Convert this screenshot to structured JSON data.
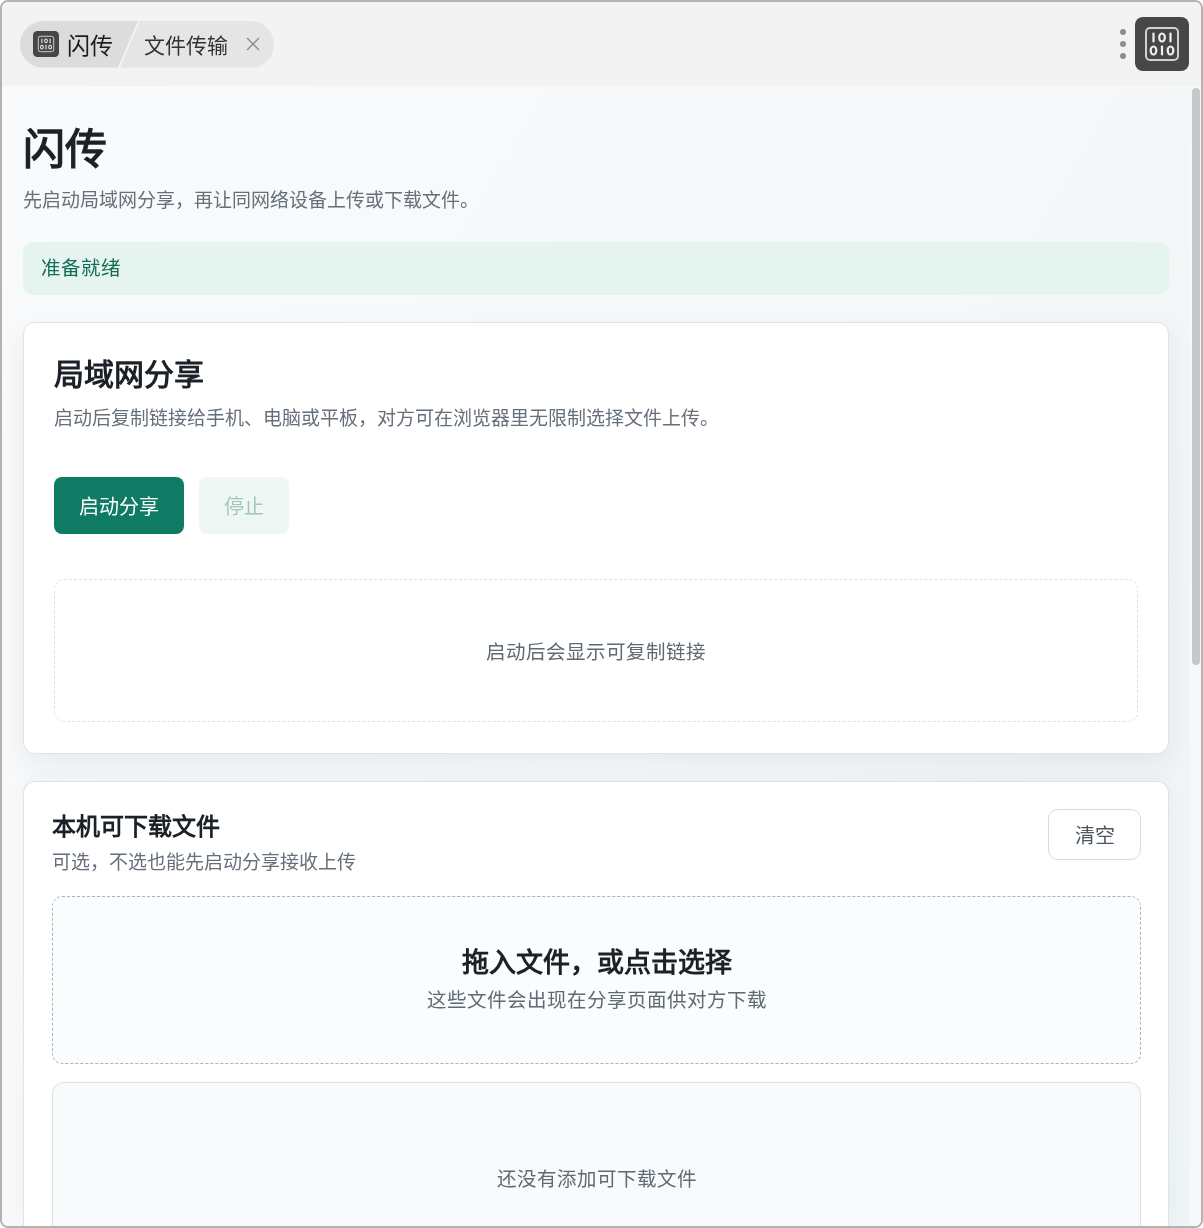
{
  "titlebar": {
    "app_name": "闪传",
    "tab": {
      "label": "文件传输"
    }
  },
  "header": {
    "title": "闪传",
    "subtitle": "先启动局域网分享，再让同网络设备上传或下载文件。"
  },
  "status": {
    "text": "准备就绪"
  },
  "share_card": {
    "title": "局域网分享",
    "description": "启动后复制链接给手机、电脑或平板，对方可在浏览器里无限制选择文件上传。",
    "buttons": [
      {
        "label": "启动分享",
        "kind": "primary",
        "disabled": false
      },
      {
        "label": "停止",
        "kind": "secondary",
        "disabled": true
      }
    ],
    "link_box": {
      "empty_text": "启动后会显示可复制链接"
    }
  },
  "files_card": {
    "title": "本机可下载文件",
    "subtitle": "可选，不选也能先启动分享接收上传",
    "clear_button": {
      "label": "清空"
    },
    "drop_zone": {
      "title": "拖入文件，或点击选择",
      "hint": "这些文件会出现在分享页面供对方下载"
    },
    "file_list": {
      "empty_text": "还没有添加可下载文件"
    }
  }
}
